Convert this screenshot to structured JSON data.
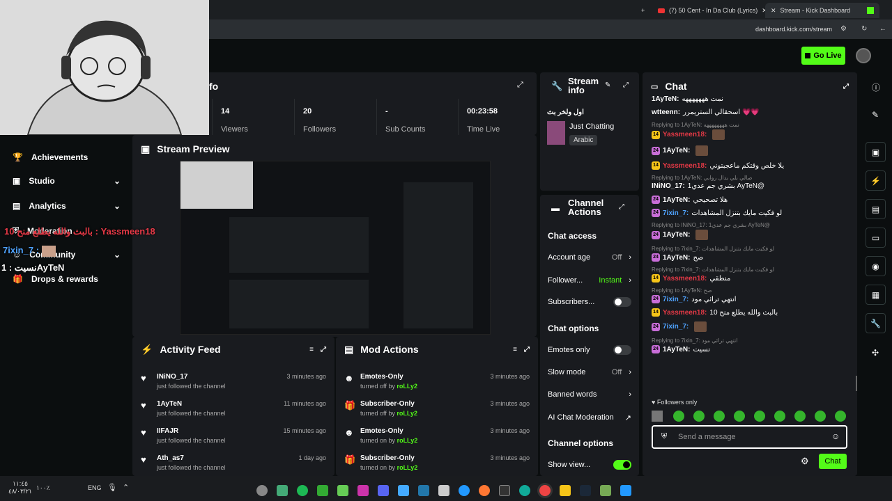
{
  "browser": {
    "tabs": [
      {
        "label": "(7) 50 Cent - In Da Club (Lyrics)"
      },
      {
        "label": "Stream - Kick Dashboard"
      }
    ],
    "url": "dashboard.kick.com/stream"
  },
  "header": {
    "go_live": "Go Live"
  },
  "sidebar": {
    "items": [
      {
        "label": "Achievements",
        "icon": "trophy-icon"
      },
      {
        "label": "Studio",
        "icon": "studio-icon"
      },
      {
        "label": "Analytics",
        "icon": "analytics-icon"
      },
      {
        "label": "Moderation",
        "icon": "shield-icon"
      },
      {
        "label": "Community",
        "icon": "community-icon"
      },
      {
        "label": "Drops & rewards",
        "icon": "gift-icon"
      }
    ]
  },
  "session_info": {
    "title_fragment": "fo",
    "stats": [
      {
        "value": "14",
        "label": "Viewers"
      },
      {
        "value": "20",
        "label": "Followers"
      },
      {
        "value": "-",
        "label": "Sub Counts"
      },
      {
        "value": "00:23:58",
        "label": "Time Live"
      }
    ]
  },
  "stream_preview": {
    "title": "Stream Preview"
  },
  "stream_info": {
    "title_line1": "Stream",
    "title_line2": "info",
    "stream_title": "اول ولخر بث",
    "category": "Just Chatting",
    "language": "Arabic"
  },
  "channel_actions": {
    "title_line1": "Channel",
    "title_line2": "Actions",
    "chat_access_header": "Chat access",
    "account_age_label": "Account age",
    "account_age_value": "Off",
    "followers_label": "Follower...",
    "followers_value": "Instant",
    "subscribers_label": "Subscribers...",
    "chat_options_header": "Chat options",
    "emotes_only_label": "Emotes only",
    "slow_mode_label": "Slow mode",
    "slow_mode_value": "Off",
    "banned_words_label": "Banned words",
    "ai_moderation_label": "AI Chat Moderation",
    "channel_options_header": "Channel options",
    "show_view_label": "Show view..."
  },
  "activity_feed": {
    "title": "Activity Feed",
    "items": [
      {
        "name": "INiNO_17",
        "sub": "just followed the channel",
        "time": "3 minutes ago"
      },
      {
        "name": "1AyTeN",
        "sub": "just followed the channel",
        "time": "11 minutes ago"
      },
      {
        "name": "IIFAJR",
        "sub": "just followed the channel",
        "time": "15 minutes ago"
      },
      {
        "name": "Ath_as7",
        "sub": "just followed the channel",
        "time": "1 day ago"
      }
    ]
  },
  "mod_actions": {
    "title": "Mod Actions",
    "items": [
      {
        "name": "Emotes-Only",
        "sub_prefix": "turned off by",
        "by": "roLLy2",
        "time": "3 minutes ago"
      },
      {
        "name": "Subscriber-Only",
        "sub_prefix": "turned off by",
        "by": "roLLy2",
        "time": "3 minutes ago"
      },
      {
        "name": "Emotes-Only",
        "sub_prefix": "turned on by",
        "by": "roLLy2",
        "time": "3 minutes ago"
      },
      {
        "name": "Subscriber-Only",
        "sub_prefix": "turned on by",
        "by": "roLLy2",
        "time": "3 minutes ago"
      }
    ]
  },
  "chat": {
    "title": "Chat",
    "followers_only": "Followers only",
    "input_placeholder": "Send a message",
    "send_label": "Chat",
    "messages": [
      {
        "type": "msg",
        "badge": "",
        "user": "1AyTeN:",
        "color": "#ffffff",
        "text": "نمت هههههههه"
      },
      {
        "type": "msg",
        "badge": "",
        "user": "wtteenn:",
        "color": "#ffffff",
        "text": "اسحقالي الستريمرر 💗💗"
      },
      {
        "type": "reply",
        "text": "Replying to 1AyTeN: نمت ههههههههه"
      },
      {
        "type": "msg",
        "badge": "14",
        "user": "Yassmeen18:",
        "color": "#e63946",
        "text": ""
      },
      {
        "type": "msg",
        "badge": "24",
        "user": "1AyTeN:",
        "color": "#ffffff",
        "text": ""
      },
      {
        "type": "msg",
        "badge": "14",
        "user": "Yassmeen18:",
        "color": "#e63946",
        "text": "يلا خلص وقتكم ماعجبتوني"
      },
      {
        "type": "reply",
        "text": "Replying to 1AyTeN: صالي بلي بدال روابي"
      },
      {
        "type": "msg",
        "badge": "",
        "user": "INiNO_17:",
        "color": "#ffffff",
        "text": "1بشري جم عدي AyTeN@"
      },
      {
        "type": "msg",
        "badge": "24",
        "user": "1AyTeN:",
        "color": "#ffffff",
        "text": "هلا تصحيحي"
      },
      {
        "type": "msg",
        "badge": "24",
        "user": "7ixin_7:",
        "color": "#4fa3ff",
        "text": "لو فكيت مايك بتنزل المشاهدات"
      },
      {
        "type": "reply",
        "text": "Replying to INiNO_17: 1بشري جم عدي AyTeN@"
      },
      {
        "type": "msg",
        "badge": "24",
        "user": "1AyTeN:",
        "color": "#ffffff",
        "text": ""
      },
      {
        "type": "reply",
        "text": "Replying to 7ixin_7: لو فكيت مايك بتنزل المشاهدات"
      },
      {
        "type": "msg",
        "badge": "24",
        "user": "1AyTeN:",
        "color": "#ffffff",
        "text": "صح"
      },
      {
        "type": "reply",
        "text": "Replying to 7ixin_7: لو فكيت مايك بتنزل المشاهدات"
      },
      {
        "type": "msg",
        "badge": "14",
        "user": "Yassmeen18:",
        "color": "#e63946",
        "text": "منطقي"
      },
      {
        "type": "reply",
        "text": "Replying to 1AyTeN: صح"
      },
      {
        "type": "msg",
        "badge": "24",
        "user": "7ixin_7:",
        "color": "#4fa3ff",
        "text": "انتهي ترائي مود"
      },
      {
        "type": "msg",
        "badge": "14",
        "user": "Yassmeen18:",
        "color": "#e63946",
        "text": "بالبث والله يطلع منح 10"
      },
      {
        "type": "msg",
        "badge": "24",
        "user": "7ixin_7:",
        "color": "#4fa3ff",
        "text": ""
      },
      {
        "type": "reply",
        "text": "Replying to 7ixin_7: انتهي ترائي مود"
      },
      {
        "type": "msg",
        "badge": "24",
        "user": "1AyTeN:",
        "color": "#ffffff",
        "text": "نسيت"
      }
    ]
  },
  "overlay": {
    "line1": "بالبث والله يطلع منح 10 : Yassmeen18",
    "line2": "7ixin_7 :",
    "line3": "نسيت : 1AyTeN"
  },
  "taskbar": {
    "time": "١١:٤٥",
    "date": "٤٨/٠٣/٢١",
    "lang": "ENG",
    "battery": "١٠٠٪"
  }
}
